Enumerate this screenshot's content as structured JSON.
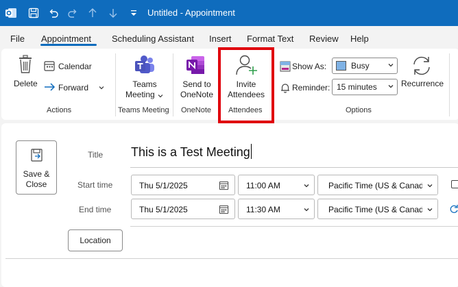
{
  "window": {
    "title": "Untitled  -  Appointment",
    "accent": "#0f6cbd"
  },
  "titlebar_icons": [
    "outlook-logo-icon",
    "save-icon",
    "undo-icon",
    "redo-icon",
    "up-arrow-icon",
    "down-arrow-icon",
    "customize-icon"
  ],
  "tabs": [
    {
      "label": "File"
    },
    {
      "label": "Appointment",
      "active": true
    },
    {
      "label": "Scheduling Assistant"
    },
    {
      "label": "Insert"
    },
    {
      "label": "Format Text"
    },
    {
      "label": "Review"
    },
    {
      "label": "Help"
    }
  ],
  "ribbon": {
    "actions": {
      "delete": "Delete",
      "calendar": "Calendar",
      "forward": "Forward",
      "group": "Actions"
    },
    "teams": {
      "line1": "Teams",
      "line2": "Meeting",
      "group": "Teams Meeting"
    },
    "onenote": {
      "line1": "Send to",
      "line2": "OneNote",
      "group": "OneNote"
    },
    "attendees": {
      "line1": "Invite",
      "line2": "Attendees",
      "group": "Attendees"
    },
    "options": {
      "show_as_label": "Show As:",
      "show_as_value": "Busy",
      "show_as_color": "#7fb2e5",
      "reminder_label": "Reminder:",
      "reminder_value": "15 minutes",
      "recurrence": "Recurrence",
      "group": "Options"
    },
    "highlight_color": "#e0000b"
  },
  "form": {
    "save_close_line1": "Save &",
    "save_close_line2": "Close",
    "title_label": "Title",
    "title_value": "This is a Test Meeting",
    "start_label": "Start time",
    "start_date": "Thu 5/1/2025",
    "start_time": "11:00 AM",
    "start_tz": "Pacific Time (US & Canada)",
    "end_label": "End time",
    "end_date": "Thu 5/1/2025",
    "end_time": "11:30 AM",
    "end_tz": "Pacific Time (US & Canada)",
    "location_button": "Location"
  }
}
